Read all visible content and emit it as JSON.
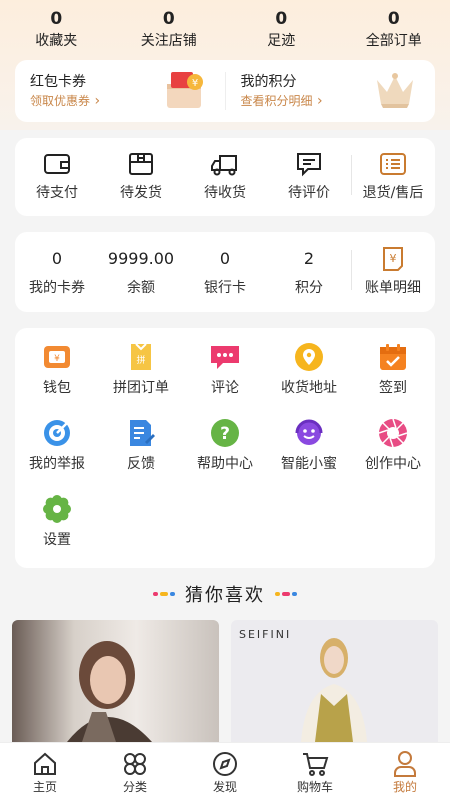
{
  "stats": [
    {
      "value": "0",
      "label": "收藏夹"
    },
    {
      "value": "0",
      "label": "关注店铺"
    },
    {
      "value": "0",
      "label": "足迹"
    },
    {
      "value": "0",
      "label": "全部订单"
    }
  ],
  "promo": {
    "coupons": {
      "title": "红包卡券",
      "link": "领取优惠券"
    },
    "points": {
      "title": "我的积分",
      "link": "查看积分明细"
    }
  },
  "orders": [
    {
      "label": "待支付",
      "icon": "wallet-icon"
    },
    {
      "label": "待发货",
      "icon": "box-icon"
    },
    {
      "label": "待收货",
      "icon": "truck-icon"
    },
    {
      "label": "待评价",
      "icon": "comment-icon"
    },
    {
      "label": "退货/售后",
      "icon": "return-icon"
    }
  ],
  "funds": [
    {
      "value": "0",
      "label": "我的卡券"
    },
    {
      "value": "9999.00",
      "label": "余额"
    },
    {
      "value": "0",
      "label": "银行卡"
    },
    {
      "value": "2",
      "label": "积分"
    },
    {
      "label": "账单明细",
      "icon": "bill-icon"
    }
  ],
  "tools": [
    {
      "label": "钱包",
      "icon": "wallet-icon",
      "color": "#f28a32"
    },
    {
      "label": "拼团订单",
      "icon": "group-order-icon",
      "color": "#f6c544"
    },
    {
      "label": "评论",
      "icon": "comment-icon",
      "color": "#ec3a6e"
    },
    {
      "label": "收货地址",
      "icon": "location-icon",
      "color": "#f6b51e"
    },
    {
      "label": "签到",
      "icon": "calendar-icon",
      "color": "#f58220"
    },
    {
      "label": "我的举报",
      "icon": "report-icon",
      "color": "#3a92e8"
    },
    {
      "label": "反馈",
      "icon": "feedback-icon",
      "color": "#3a87e0"
    },
    {
      "label": "帮助中心",
      "icon": "help-icon",
      "color": "#66b445"
    },
    {
      "label": "智能小蜜",
      "icon": "assistant-icon",
      "color": "#8a49e0"
    },
    {
      "label": "创作中心",
      "icon": "camera-aperture-icon",
      "color": "#e84c84"
    },
    {
      "label": "设置",
      "icon": "gear-icon",
      "color": "#66b445"
    }
  ],
  "recommend": {
    "title": "猜你喜欢",
    "brand": "SEIFINI"
  },
  "tabs": [
    {
      "label": "主页",
      "icon": "home-icon"
    },
    {
      "label": "分类",
      "icon": "category-icon"
    },
    {
      "label": "发现",
      "icon": "compass-icon"
    },
    {
      "label": "购物车",
      "icon": "cart-icon"
    },
    {
      "label": "我的",
      "icon": "user-icon",
      "active": true
    }
  ],
  "colors": {
    "accent": "#c47a3c",
    "link": "#c9874a",
    "icon_brown": "#c97b30"
  }
}
